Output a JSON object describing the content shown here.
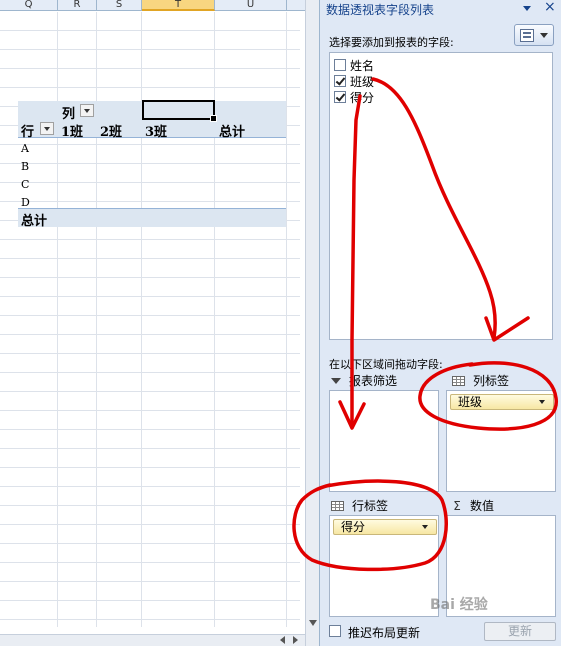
{
  "sheet": {
    "columns": [
      "Q",
      "R",
      "S",
      "T",
      "U"
    ],
    "selected_column": "T"
  },
  "pivot": {
    "col_label": "列",
    "row_label": "行",
    "col_headers": [
      "1班",
      "2班",
      "3班"
    ],
    "grand_total_header": "总计",
    "rows": [
      "A",
      "B",
      "C",
      "D"
    ],
    "grand_total_row": "总计"
  },
  "pane": {
    "title": "数据透视表字段列表",
    "close": "×",
    "choose_label": "选择要添加到报表的字段:",
    "fields": [
      {
        "name": "姓名",
        "checked": false
      },
      {
        "name": "班级",
        "checked": true
      },
      {
        "name": "得分",
        "checked": true
      }
    ],
    "drag_label": "在以下区域间拖动字段:",
    "zones": {
      "filter": {
        "label": "报表筛选",
        "items": []
      },
      "columns": {
        "label": "列标签",
        "items": [
          "班级"
        ]
      },
      "rows": {
        "label": "行标签",
        "items": [
          "得分"
        ]
      },
      "values": {
        "label": "数值",
        "items": []
      }
    },
    "values_symbol": "Σ",
    "defer_label": "推迟布局更新",
    "update_label": "更新"
  },
  "watermark": "Bai 经验",
  "colors": {
    "annotation": "#e00000",
    "pivot_header_band": "#dce6f1",
    "pane_bg": "#dfe8f5"
  }
}
